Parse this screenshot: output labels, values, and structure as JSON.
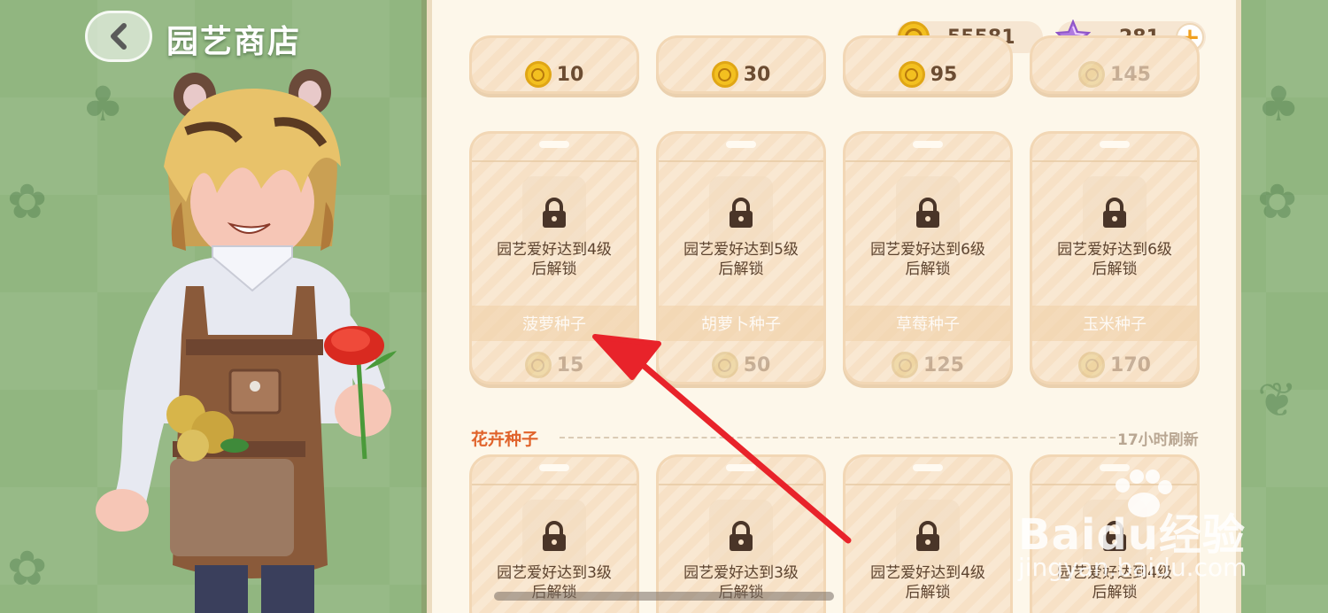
{
  "header": {
    "title": "园艺商店"
  },
  "currency": {
    "coins": "55581",
    "stars": "281",
    "plus_label": "+"
  },
  "top_row_prices": [
    "10",
    "30",
    "95",
    "145"
  ],
  "locked_cards": [
    {
      "lock_line1": "园艺爱好达到4级",
      "lock_line2": "后解锁",
      "name": "菠萝种子",
      "price": "15"
    },
    {
      "lock_line1": "园艺爱好达到5级",
      "lock_line2": "后解锁",
      "name": "胡萝卜种子",
      "price": "50"
    },
    {
      "lock_line1": "园艺爱好达到6级",
      "lock_line2": "后解锁",
      "name": "草莓种子",
      "price": "125"
    },
    {
      "lock_line1": "园艺爱好达到6级",
      "lock_line2": "后解锁",
      "name": "玉米种子",
      "price": "170"
    }
  ],
  "flower_section": {
    "title": "花卉种子",
    "refresh": "17小时刷新"
  },
  "flower_cards": [
    {
      "lock_line1": "园艺爱好达到3级",
      "lock_line2": "后解锁"
    },
    {
      "lock_line1": "园艺爱好达到3级",
      "lock_line2": "后解锁"
    },
    {
      "lock_line1": "园艺爱好达到4级",
      "lock_line2": "后解锁"
    },
    {
      "lock_line1": "园艺爱好达到4级",
      "lock_line2": "后解锁"
    }
  ],
  "watermark": {
    "brand": "Baidu经验",
    "url": "jingyan.baidu.com"
  },
  "colors": {
    "accent": "#e0632b",
    "panel": "#fdf7ea",
    "card": "#f7e1c6",
    "arrow": "#e8232a",
    "coin": "#f3c020"
  },
  "icons": {
    "back": "chevron-left-icon",
    "coin": "coin-icon",
    "star": "star-icon",
    "lock": "lock-icon"
  }
}
